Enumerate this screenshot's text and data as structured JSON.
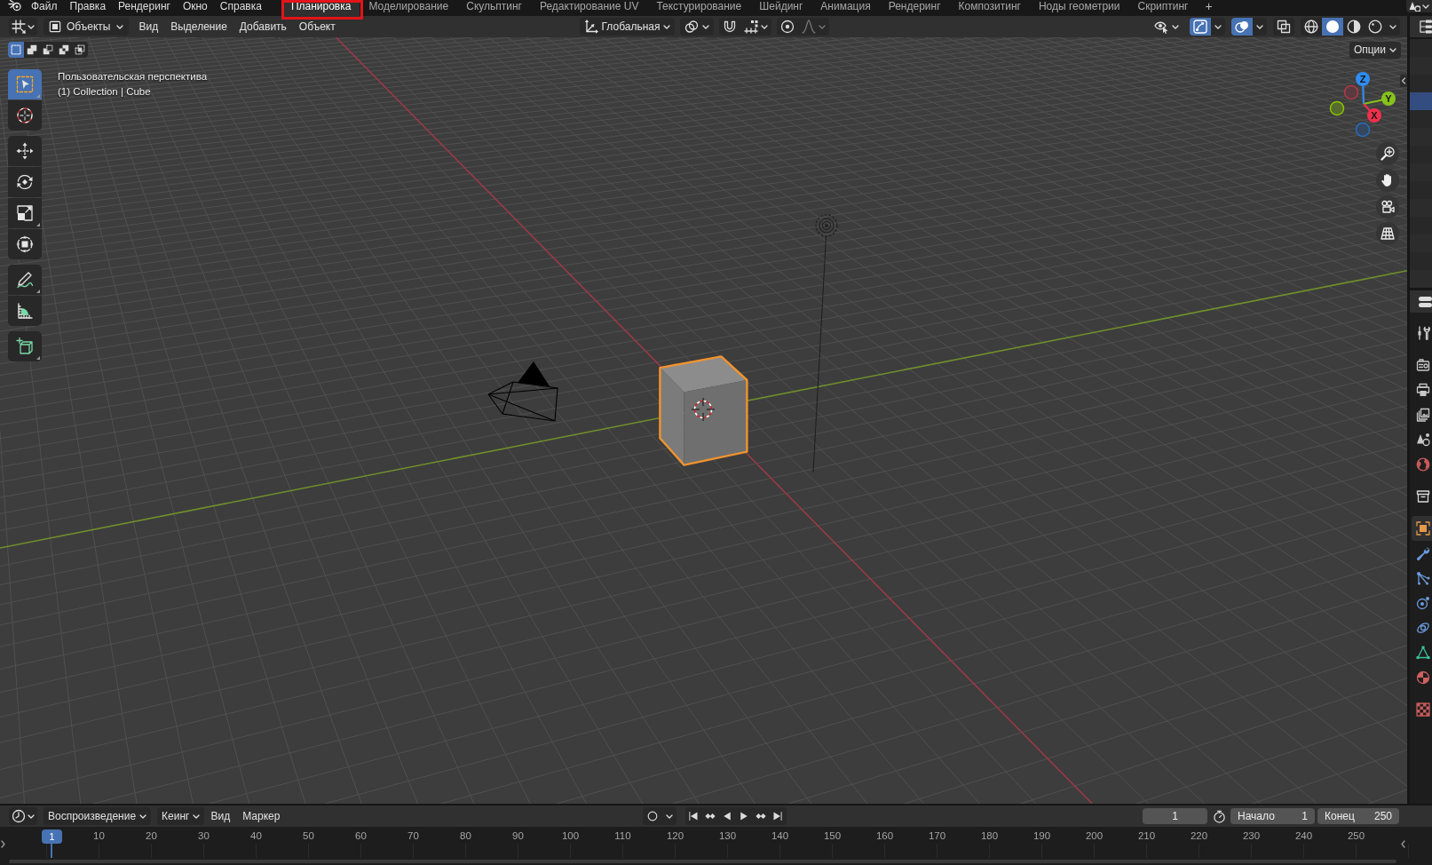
{
  "top_bar": {
    "menus": [
      "Файл",
      "Правка",
      "Рендеринг",
      "Окно",
      "Справка"
    ],
    "workspaces": [
      {
        "label": "Планировка",
        "selected": true,
        "outlined": true
      },
      {
        "label": "Моделирование",
        "selected": false,
        "outlined": false
      },
      {
        "label": "Скульптинг",
        "selected": false,
        "outlined": false
      },
      {
        "label": "Редактирование UV",
        "selected": false,
        "outlined": false
      },
      {
        "label": "Текстурирование",
        "selected": false,
        "outlined": false
      },
      {
        "label": "Шейдинг",
        "selected": false,
        "outlined": false
      },
      {
        "label": "Анимация",
        "selected": false,
        "outlined": false
      },
      {
        "label": "Рендеринг",
        "selected": false,
        "outlined": false
      },
      {
        "label": "Композитинг",
        "selected": false,
        "outlined": false
      },
      {
        "label": "Ноды геометрии",
        "selected": false,
        "outlined": false
      },
      {
        "label": "Скриптинг",
        "selected": false,
        "outlined": false
      }
    ],
    "add_workspace": "+"
  },
  "viewport_header": {
    "mode": "Объекты",
    "menus": [
      "Вид",
      "Выделение",
      "Добавить",
      "Объект"
    ],
    "orientation": "Глобальная",
    "snap": {
      "on": false
    },
    "proportional_editing": {
      "on": false
    },
    "gizmos": {
      "on": true
    },
    "overlays": {
      "on": true
    },
    "xray": {
      "on": false
    },
    "shading": [
      {
        "kind": "wireframe",
        "selected": false
      },
      {
        "kind": "solid",
        "selected": true
      },
      {
        "kind": "material",
        "selected": false
      },
      {
        "kind": "rendered",
        "selected": false
      }
    ]
  },
  "tool_settings": {
    "select_modes": [
      {
        "kind": "new",
        "selected": true
      },
      {
        "kind": "extend",
        "selected": false
      },
      {
        "kind": "subtract",
        "selected": false
      },
      {
        "kind": "invert",
        "selected": false
      },
      {
        "kind": "intersect",
        "selected": false
      }
    ],
    "options": "Опции"
  },
  "toolbar": {
    "groups": [
      {
        "tools": [
          {
            "kind": "select_box",
            "selected": true,
            "more": true
          },
          {
            "kind": "cursor",
            "selected": false,
            "more": false
          }
        ]
      },
      {
        "tools": [
          {
            "kind": "move",
            "selected": false,
            "more": false
          },
          {
            "kind": "rotate",
            "selected": false,
            "more": false
          },
          {
            "kind": "scale",
            "selected": false,
            "more": true
          },
          {
            "kind": "transform",
            "selected": false,
            "more": false
          }
        ]
      },
      {
        "tools": [
          {
            "kind": "annotate",
            "selected": false,
            "more": true
          },
          {
            "kind": "measure",
            "selected": false,
            "more": false
          }
        ]
      },
      {
        "tools": [
          {
            "kind": "add_cube",
            "selected": false,
            "more": true
          }
        ]
      }
    ]
  },
  "viewport": {
    "view_name": "Пользовательская перспектива",
    "context": "(1) Collection | Cube",
    "gizmo": {
      "x": "X",
      "y": "Y",
      "z": "Z"
    },
    "objects": [
      {
        "kind": "camera",
        "selected": false
      },
      {
        "kind": "light",
        "selected": false
      },
      {
        "kind": "cube",
        "selected": true
      }
    ]
  },
  "outliner": {
    "rows": [
      {
        "selected": false
      },
      {
        "selected": false
      },
      {
        "selected": false
      },
      {
        "selected": true
      },
      {
        "selected": false
      },
      {
        "selected": false
      },
      {
        "selected": false
      },
      {
        "selected": false
      },
      {
        "selected": false
      },
      {
        "selected": false
      },
      {
        "selected": false
      },
      {
        "selected": false
      },
      {
        "selected": false
      },
      {
        "selected": false
      }
    ]
  },
  "properties": {
    "groups": [
      {
        "tabs": [
          {
            "kind": "tool",
            "selected": false
          }
        ]
      },
      {
        "tabs": [
          {
            "kind": "render",
            "selected": false
          },
          {
            "kind": "output",
            "selected": false
          },
          {
            "kind": "view_layer",
            "selected": false
          },
          {
            "kind": "scene",
            "selected": false
          },
          {
            "kind": "world",
            "selected": false
          }
        ]
      },
      {
        "tabs": [
          {
            "kind": "collection",
            "selected": false
          }
        ]
      },
      {
        "tabs": [
          {
            "kind": "object",
            "selected": true
          },
          {
            "kind": "modifiers",
            "selected": false
          },
          {
            "kind": "particles",
            "selected": false
          },
          {
            "kind": "physics",
            "selected": false
          },
          {
            "kind": "constraints",
            "selected": false
          },
          {
            "kind": "data",
            "selected": false
          },
          {
            "kind": "material",
            "selected": false
          }
        ]
      },
      {
        "tabs": [
          {
            "kind": "texture",
            "selected": false
          }
        ]
      }
    ]
  },
  "timeline": {
    "menus": [
      {
        "label": "Воспроизведение",
        "kind": "dropdown"
      },
      {
        "label": "Кеинг",
        "kind": "dropdown"
      },
      {
        "label": "Вид",
        "kind": "menu"
      },
      {
        "label": "Маркер",
        "kind": "menu"
      }
    ],
    "auto_keying": {
      "on": false
    },
    "current_frame": "1",
    "preview_range": {
      "on": false
    },
    "start": {
      "label": "Начало",
      "value": "1"
    },
    "end": {
      "label": "Конец",
      "value": "250"
    },
    "ruler": {
      "current": "1",
      "labels": [
        "10",
        "20",
        "30",
        "40",
        "50",
        "60",
        "70",
        "80",
        "90",
        "100",
        "110",
        "120",
        "130",
        "140",
        "150",
        "160",
        "170",
        "180",
        "190",
        "200",
        "210",
        "220",
        "230",
        "240",
        "250"
      ]
    }
  }
}
